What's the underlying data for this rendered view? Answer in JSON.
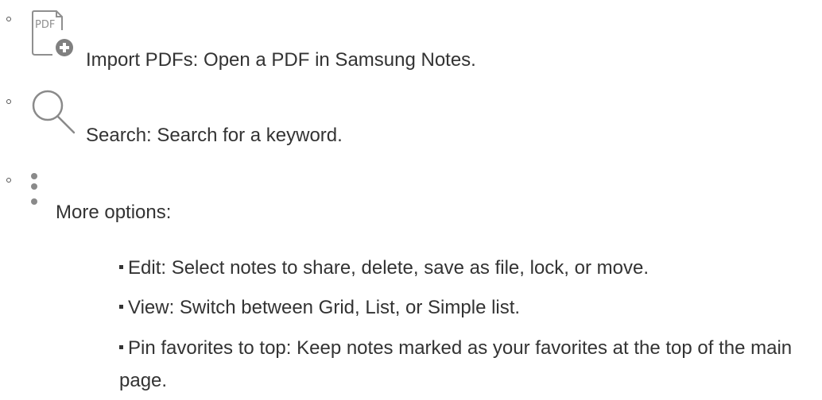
{
  "items": [
    {
      "icon": "pdf-import-icon",
      "icon_text": "PDF",
      "text": "Import PDFs: Open a PDF in Samsung Notes."
    },
    {
      "icon": "search-icon",
      "text": "Search: Search for a keyword."
    },
    {
      "icon": "more-options-icon",
      "text": "More options:",
      "subitems": [
        "Edit: Select notes to share, delete, save as file, lock, or move.",
        "View: Switch between Grid, List, or Simple list.",
        "Pin favorites to top: Keep notes marked as your favorites at the top of the main page."
      ]
    }
  ]
}
